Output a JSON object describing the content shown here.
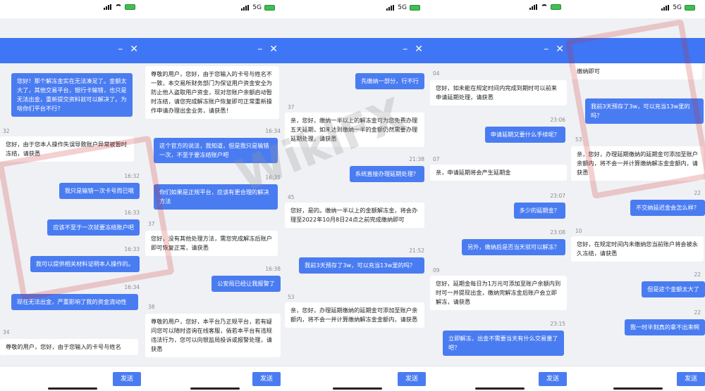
{
  "status": {
    "net": "5G"
  },
  "send_label": "发送",
  "panels": [
    {
      "msgs": [
        {
          "side": "right",
          "text": "您好！那个解冻金实在无法凑足了。金额太大了，其他交易平台，银行卡输错，也只是无法出金，重新提交资料就可以解决了。为啥你们平台不行？"
        },
        {
          "side": "time",
          "text": "32"
        },
        {
          "side": "left",
          "text": "您好，由于您本人操作失误导致账户异常被暂时冻结，请获悉"
        },
        {
          "side": "time",
          "text": "16:32"
        },
        {
          "side": "right",
          "text": "我只是输错一次卡号而已哦"
        },
        {
          "side": "time",
          "text": "16:33"
        },
        {
          "side": "right",
          "text": "应该不至于一次就要冻结账户吧"
        },
        {
          "side": "time",
          "text": "16:33"
        },
        {
          "side": "right",
          "text": "我可以提供相关材料证明本人操作的。"
        },
        {
          "side": "time",
          "text": "16:34"
        },
        {
          "side": "right",
          "text": "现在无法出金，严重影响了我的资金流动性"
        },
        {
          "side": "time",
          "text": "34"
        },
        {
          "side": "left",
          "text": "尊敬的用户，您好，由于您输入的卡号与姓名"
        }
      ]
    },
    {
      "msgs": [
        {
          "side": "left",
          "text": "尊敬的用户，您好，由于您输入的卡号与姓名不一致，本交易所财务部门为保证用户资金安全为防止他人盗取用户资金，现对您账户余额启动暂时冻结，请您完成解冻账户恢复即可正常重新操作申请办理出金业务，请获悉！"
        },
        {
          "side": "time",
          "text": "16:34"
        },
        {
          "side": "right",
          "text": "这个官方的说法，我知道，但是我只是输错一次，不至于要冻结账户吧"
        },
        {
          "side": "time",
          "text": "16:35"
        },
        {
          "side": "right",
          "text": "你们如果是正规平台，应该有更合理的解决方法"
        },
        {
          "side": "time",
          "text": "37"
        },
        {
          "side": "left",
          "text": "您好，没有其他处理方法，需您完成解冻后账户即可恢复正常，请获悉"
        },
        {
          "side": "time",
          "text": "16:38"
        },
        {
          "side": "right",
          "text": "公安局已经让我报警了"
        },
        {
          "side": "time",
          "text": "38"
        },
        {
          "side": "left",
          "text": "尊敬的用户，您好，本平台乃正规平台，若有疑问您可以随时咨询在线客服，倘若本平台有违规违法行为，您可以向银监局投诉或报警处理，请获悉"
        }
      ]
    },
    {
      "msgs": [
        {
          "side": "right",
          "text": "先缴纳一部分，行不行"
        },
        {
          "side": "time",
          "text": "37"
        },
        {
          "side": "left",
          "text": "亲，您好，缴纳一半以上的解冻金可为您免费办理五天延期，如未达到缴纳一半的金额仍然需要办理延期处理，请获悉"
        },
        {
          "side": "time",
          "text": "21:38"
        },
        {
          "side": "right",
          "text": "系统直接办理延期处理？"
        },
        {
          "side": "time",
          "text": "45"
        },
        {
          "side": "left",
          "text": "您好，是的。缴纳一半以上的金额解冻金，将会办理至2022年10月8日24点之前完成缴纳即可"
        },
        {
          "side": "time",
          "text": "21:52"
        },
        {
          "side": "right",
          "text": "我前3天预存了3w，可以充当13w里的吗？"
        },
        {
          "side": "time",
          "text": "53"
        },
        {
          "side": "left",
          "text": "亲，您好，办理延期缴纳的延期金可添加至账户余额内，将不会一并计算缴纳解冻金金额内，请获悉"
        }
      ]
    },
    {
      "msgs": [
        {
          "side": "time",
          "text": "04"
        },
        {
          "side": "left",
          "text": "您好，如未能在规定时间内完成到期时可以前来申请延期处理，请获悉"
        },
        {
          "side": "time",
          "text": "23:06"
        },
        {
          "side": "right",
          "text": "申请延期又要什么手续呢？"
        },
        {
          "side": "time",
          "text": "07"
        },
        {
          "side": "left",
          "text": "亲，申请延期将会产生延期金"
        },
        {
          "side": "time",
          "text": "23:07"
        },
        {
          "side": "right",
          "text": "多少的延期金？"
        },
        {
          "side": "time",
          "text": "23:08"
        },
        {
          "side": "right",
          "text": "另外，缴纳后是否当天就可以解冻？"
        },
        {
          "side": "time",
          "text": "09"
        },
        {
          "side": "left",
          "text": "您好，延期金每日为1万元可添加至账户余额内到时可一并提现出金，缴纳完解冻金后账户会立即解冻，请获悉"
        },
        {
          "side": "time",
          "text": "23:15"
        },
        {
          "side": "right",
          "text": "立即解冻，出金不需要当天有什么交易量了吧？"
        }
      ]
    },
    {
      "msgs": [
        {
          "side": "left",
          "text": "缴纳即可"
        },
        {
          "side": "right",
          "text": "我前3天预存了3w，可以充当13w里的吗？"
        },
        {
          "side": "time",
          "text": "53"
        },
        {
          "side": "left",
          "text": "亲，您好，办理延期缴纳的延期金可添加至账户余额内，将不会一并计算缴纳解冻金金额内，请获悉"
        },
        {
          "side": "time",
          "text": "22"
        },
        {
          "side": "right",
          "text": "不交纳延迟金会怎么样？"
        },
        {
          "side": "time",
          "text": "10"
        },
        {
          "side": "left",
          "text": "您好，在规定时间内未缴纳您当前账户将会被永久冻结，请获悉"
        },
        {
          "side": "time",
          "text": "22"
        },
        {
          "side": "right",
          "text": "但是这个金额太大了"
        },
        {
          "side": "time",
          "text": "22"
        },
        {
          "side": "right",
          "text": "我一时半刻真的拿不出来啊"
        }
      ]
    }
  ]
}
